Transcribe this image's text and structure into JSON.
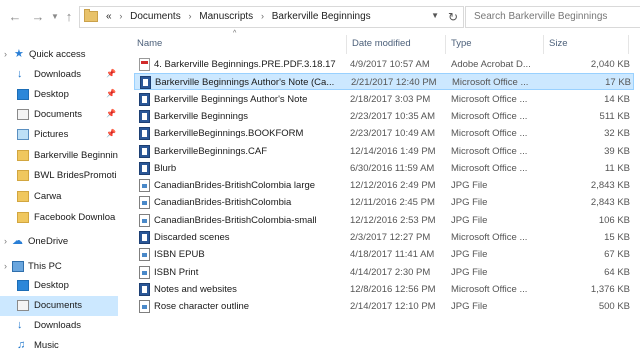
{
  "toolbar": {
    "back_icon": "arrow-left-icon",
    "forward_icon": "arrow-right-icon",
    "recent_icon": "chevron-down-icon",
    "up_icon": "arrow-up-icon"
  },
  "address": {
    "overflow": "«",
    "crumbs": [
      "Documents",
      "Manuscripts",
      "Barkerville Beginnings"
    ],
    "separator": "›"
  },
  "search": {
    "placeholder": "Search Barkerville Beginnings"
  },
  "sidebar": {
    "quick_access": "Quick access",
    "items": [
      {
        "label": "Downloads",
        "icon": "download-arrow-icon",
        "pinned": true
      },
      {
        "label": "Desktop",
        "icon": "desktop-icon",
        "pinned": true
      },
      {
        "label": "Documents",
        "icon": "documents-icon",
        "pinned": true
      },
      {
        "label": "Pictures",
        "icon": "pictures-icon",
        "pinned": true
      },
      {
        "label": "Barkerville Beginning",
        "icon": "folder-icon",
        "pinned": false
      },
      {
        "label": "BWL BridesPromoti",
        "icon": "folder-icon",
        "pinned": false
      },
      {
        "label": "Carwa",
        "icon": "folder-icon",
        "pinned": false
      },
      {
        "label": "Facebook Downloa",
        "icon": "folder-icon",
        "pinned": false
      }
    ],
    "onedrive": "OneDrive",
    "this_pc": "This PC",
    "pc_items": [
      {
        "label": "Desktop",
        "icon": "desktop-icon",
        "selected": false
      },
      {
        "label": "Documents",
        "icon": "documents-icon",
        "selected": true
      },
      {
        "label": "Downloads",
        "icon": "download-arrow-icon",
        "selected": false
      },
      {
        "label": "Music",
        "icon": "music-icon",
        "selected": false
      }
    ]
  },
  "columns": {
    "name": "Name",
    "date": "Date modified",
    "type": "Type",
    "size": "Size"
  },
  "files": [
    {
      "name": "4. Barkerville Beginnings.PRE.PDF.3.18.17",
      "date": "4/9/2017 10:57 AM",
      "type": "Adobe Acrobat D...",
      "size": "2,040 KB",
      "kind": "pdf"
    },
    {
      "name": "Barkerville Beginnings Author's Note (Ca...",
      "date": "2/21/2017 12:40 PM",
      "type": "Microsoft Office ...",
      "size": "17 KB",
      "kind": "word",
      "selected": true
    },
    {
      "name": "Barkerville Beginnings Author's Note",
      "date": "2/18/2017 3:03 PM",
      "type": "Microsoft Office ...",
      "size": "14 KB",
      "kind": "word"
    },
    {
      "name": "Barkerville Beginnings",
      "date": "2/23/2017 10:35 AM",
      "type": "Microsoft Office ...",
      "size": "511 KB",
      "kind": "word"
    },
    {
      "name": "BarkervilleBeginnings.BOOKFORM",
      "date": "2/23/2017 10:49 AM",
      "type": "Microsoft Office ...",
      "size": "32 KB",
      "kind": "word"
    },
    {
      "name": "BarkervilleBeginnings.CAF",
      "date": "12/14/2016 1:49 PM",
      "type": "Microsoft Office ...",
      "size": "39 KB",
      "kind": "word"
    },
    {
      "name": "Blurb",
      "date": "6/30/2016 11:59 AM",
      "type": "Microsoft Office ...",
      "size": "11 KB",
      "kind": "word"
    },
    {
      "name": "CanadianBrides-BritishColombia large",
      "date": "12/12/2016 2:49 PM",
      "type": "JPG File",
      "size": "2,843 KB",
      "kind": "jpg"
    },
    {
      "name": "CanadianBrides-BritishColombia",
      "date": "12/11/2016 2:45 PM",
      "type": "JPG File",
      "size": "2,843 KB",
      "kind": "jpg"
    },
    {
      "name": "CanadianBrides-BritishColombia-small",
      "date": "12/12/2016 2:53 PM",
      "type": "JPG File",
      "size": "106 KB",
      "kind": "jpg"
    },
    {
      "name": "Discarded scenes",
      "date": "2/3/2017 12:27 PM",
      "type": "Microsoft Office ...",
      "size": "15 KB",
      "kind": "word"
    },
    {
      "name": "ISBN EPUB",
      "date": "4/18/2017 11:41 AM",
      "type": "JPG File",
      "size": "67 KB",
      "kind": "jpg"
    },
    {
      "name": "ISBN Print",
      "date": "4/14/2017 2:30 PM",
      "type": "JPG File",
      "size": "64 KB",
      "kind": "jpg"
    },
    {
      "name": "Notes and websites",
      "date": "12/8/2016 12:56 PM",
      "type": "Microsoft Office ...",
      "size": "1,376 KB",
      "kind": "word"
    },
    {
      "name": "Rose character outline",
      "date": "2/14/2017 12:10 PM",
      "type": "JPG File",
      "size": "500 KB",
      "kind": "jpg"
    }
  ]
}
